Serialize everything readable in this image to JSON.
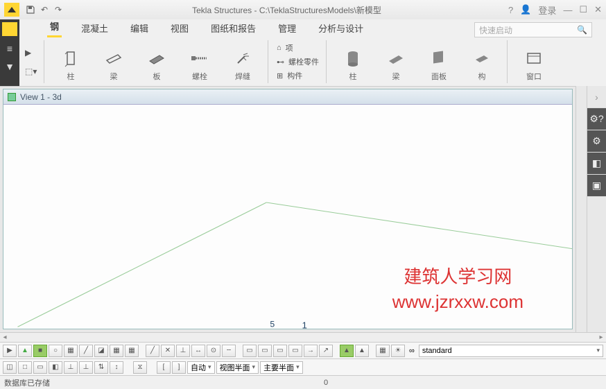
{
  "titlebar": {
    "title": "Tekla Structures - C:\\TeklaStructuresModels\\新模型",
    "login": "登录"
  },
  "menu": {
    "items": [
      "钢",
      "混凝土",
      "编辑",
      "视图",
      "图纸和报告",
      "管理",
      "分析与设计"
    ],
    "search_placeholder": "快速启动"
  },
  "tools_steel": {
    "column": "柱",
    "beam": "梁",
    "plate": "板",
    "bolt": "螺栓",
    "weld": "焊缝"
  },
  "mini": {
    "item": "项",
    "boltpart": "螺栓零件",
    "member": "构件"
  },
  "tools_conc": {
    "column": "柱",
    "beam": "梁",
    "panel": "面板",
    "x": "构"
  },
  "window": {
    "label": "窗口"
  },
  "view": {
    "title": "View 1 - 3d"
  },
  "watermark": {
    "line1": "建筑人学习网",
    "line2": "www.jzrxxw.com"
  },
  "combos": {
    "auto": "自动",
    "viewhalf": "视图半面",
    "mainhalf": "主要半面",
    "standard": "standard"
  },
  "status": {
    "msg": "数据库已存储",
    "center": "0"
  }
}
